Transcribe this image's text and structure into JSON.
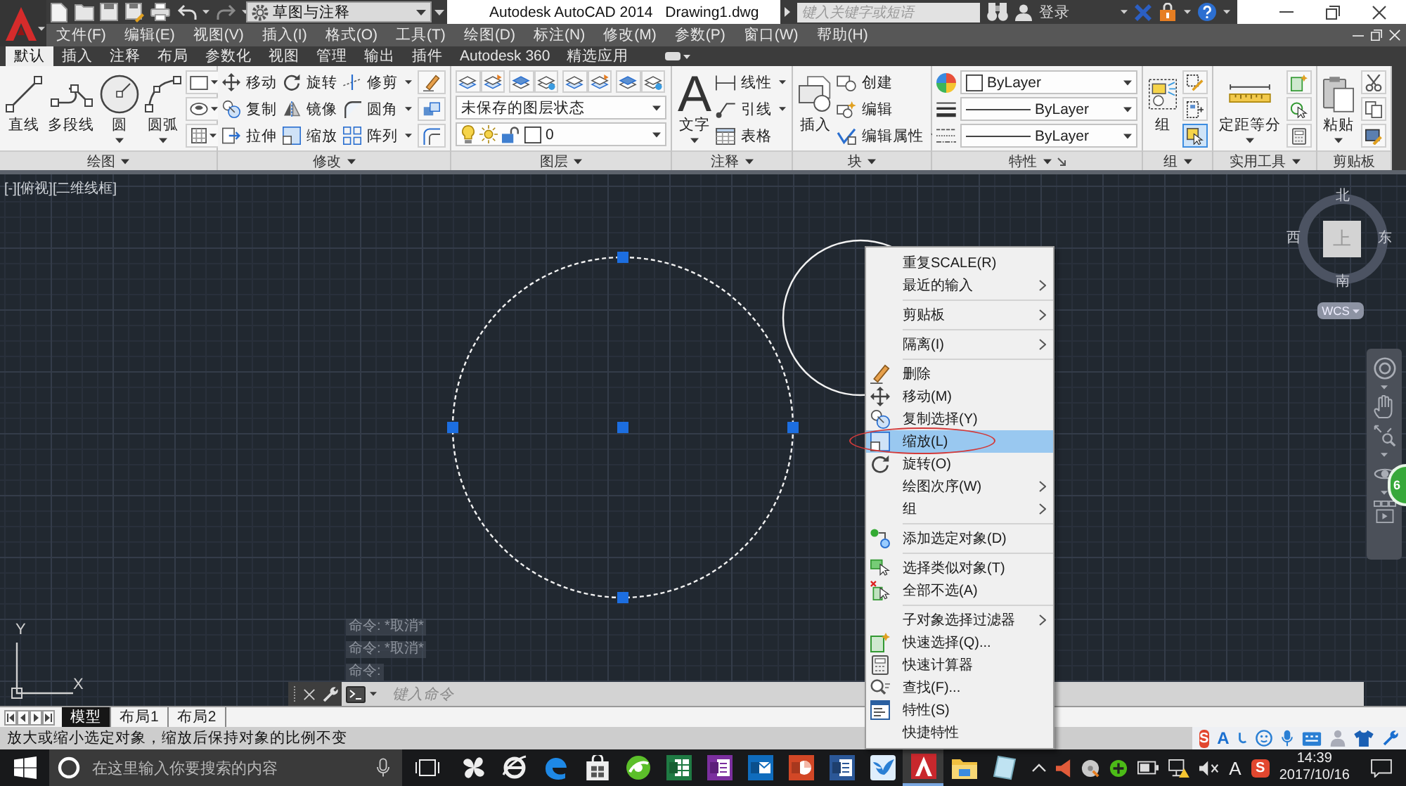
{
  "title_bar": {
    "workspace": "草图与注释",
    "app_title": "Autodesk AutoCAD 2014",
    "document": "Drawing1.dwg",
    "search": {
      "placeholder": "键入关键字或短语"
    },
    "sign_in": "登录"
  },
  "menu_bar": [
    "文件(F)",
    "编辑(E)",
    "视图(V)",
    "插入(I)",
    "格式(O)",
    "工具(T)",
    "绘图(D)",
    "标注(N)",
    "修改(M)",
    "参数(P)",
    "窗口(W)",
    "帮助(H)"
  ],
  "ribbon_tabs": [
    {
      "label": "默认",
      "selected": true
    },
    {
      "label": "插入",
      "selected": false
    },
    {
      "label": "注释",
      "selected": false
    },
    {
      "label": "布局",
      "selected": false
    },
    {
      "label": "参数化",
      "selected": false
    },
    {
      "label": "视图",
      "selected": false
    },
    {
      "label": "管理",
      "selected": false
    },
    {
      "label": "输出",
      "selected": false
    },
    {
      "label": "插件",
      "selected": false
    },
    {
      "label": "Autodesk 360",
      "selected": false
    },
    {
      "label": "精选应用",
      "selected": false
    }
  ],
  "ribbon_panels": {
    "draw": {
      "title": "绘图",
      "dropdown": true,
      "tools": [
        {
          "label": "直线",
          "dropdown": false
        },
        {
          "label": "多段线",
          "dropdown": false
        },
        {
          "label": "圆",
          "dropdown": true
        },
        {
          "label": "圆弧",
          "dropdown": true
        }
      ]
    },
    "modify": {
      "title": "修改",
      "dropdown": true,
      "tools": [
        {
          "label": "移动",
          "dropdown": false
        },
        {
          "label": "旋转",
          "dropdown": false
        },
        {
          "label": "修剪",
          "dropdown": true
        },
        {
          "label": "复制",
          "dropdown": false
        },
        {
          "label": "镜像",
          "dropdown": false
        },
        {
          "label": "圆角",
          "dropdown": true
        },
        {
          "label": "拉伸",
          "dropdown": false
        },
        {
          "label": "缩放",
          "dropdown": false
        },
        {
          "label": "阵列",
          "dropdown": true
        }
      ]
    },
    "layers": {
      "title": "图层",
      "dropdown": true,
      "layer_state": "未保存的图层状态",
      "current_layer": "0"
    },
    "annotation": {
      "title": "注释",
      "dropdown": true,
      "main_tool": {
        "icon_glyph": "A",
        "label": "文字",
        "dropdown": true
      },
      "tools": [
        {
          "label": "线性",
          "dropdown": true
        },
        {
          "label": "引线",
          "dropdown": true
        },
        {
          "label": "表格",
          "dropdown": false
        }
      ]
    },
    "block": {
      "title": "块",
      "dropdown": true,
      "main_tool": {
        "label": "插入",
        "dropdown": false
      },
      "tools": [
        {
          "label": "创建",
          "dropdown": false
        },
        {
          "label": "编辑",
          "dropdown": false
        },
        {
          "label": "编辑属性",
          "dropdown": true
        }
      ]
    },
    "properties": {
      "title": "特性",
      "dropdown": true,
      "color_setting": "ByLayer",
      "lineweight": "ByLayer",
      "linetype": "ByLayer"
    },
    "groups": {
      "title": "组",
      "dropdown": true,
      "main_tool": {
        "label": "组",
        "dropdown": false
      },
      "toggles": [
        {
          "on": false
        },
        {
          "on": false
        },
        {
          "on": true
        }
      ]
    },
    "utilities": {
      "title": "实用工具",
      "dropdown": true,
      "main_tool": {
        "label": "定距等分",
        "dropdown": true
      }
    },
    "clipboard": {
      "title": "剪贴板",
      "dropdown": false,
      "main_tool": {
        "label": "粘贴",
        "dropdown": true
      }
    }
  },
  "viewport": {
    "label": "[-][俯视][二维线框]",
    "objects": [
      {
        "kind": "circle",
        "selected": true
      },
      {
        "kind": "circle",
        "selected": false
      }
    ],
    "viewcube": {
      "north": "北",
      "west": "西",
      "face": "上",
      "east": "东",
      "south": "南",
      "coordinate_system": "WCS"
    },
    "side_badge": "6",
    "ucs": {
      "y": "Y",
      "x": "X"
    },
    "command_history": [
      "命令: *取消*",
      "命令: *取消*",
      "命令:"
    ],
    "command_line": {
      "placeholder": "键入命令"
    }
  },
  "layout_tabs": [
    {
      "label": "模型",
      "selected": true
    },
    {
      "label": "布局1",
      "selected": false
    },
    {
      "label": "布局2",
      "selected": false
    }
  ],
  "context_menu": [
    {
      "kind": "item",
      "label": "重复SCALE(R)",
      "submenu": false,
      "selected": false
    },
    {
      "kind": "item",
      "label": "最近的输入",
      "submenu": true,
      "selected": false
    },
    {
      "kind": "separator"
    },
    {
      "kind": "item",
      "label": "剪贴板",
      "submenu": true,
      "selected": false
    },
    {
      "kind": "separator"
    },
    {
      "kind": "item",
      "label": "隔离(I)",
      "submenu": true,
      "selected": false
    },
    {
      "kind": "separator"
    },
    {
      "kind": "item",
      "label": "删除",
      "submenu": false,
      "selected": false
    },
    {
      "kind": "item",
      "label": "移动(M)",
      "submenu": false,
      "selected": false
    },
    {
      "kind": "item",
      "label": "复制选择(Y)",
      "submenu": false,
      "selected": false
    },
    {
      "kind": "item",
      "label": "缩放(L)",
      "submenu": false,
      "selected": true
    },
    {
      "kind": "item",
      "label": "旋转(O)",
      "submenu": false,
      "selected": false
    },
    {
      "kind": "item",
      "label": "绘图次序(W)",
      "submenu": true,
      "selected": false
    },
    {
      "kind": "item",
      "label": "组",
      "submenu": true,
      "selected": false
    },
    {
      "kind": "separator"
    },
    {
      "kind": "item",
      "label": "添加选定对象(D)",
      "submenu": false,
      "selected": false
    },
    {
      "kind": "separator"
    },
    {
      "kind": "item",
      "label": "选择类似对象(T)",
      "submenu": false,
      "selected": false
    },
    {
      "kind": "item",
      "label": "全部不选(A)",
      "submenu": false,
      "selected": false
    },
    {
      "kind": "separator"
    },
    {
      "kind": "item",
      "label": "子对象选择过滤器",
      "submenu": true,
      "selected": false
    },
    {
      "kind": "item",
      "label": "快速选择(Q)...",
      "submenu": false,
      "selected": false
    },
    {
      "kind": "item",
      "label": "快速计算器",
      "submenu": false,
      "selected": false
    },
    {
      "kind": "item",
      "label": "查找(F)...",
      "submenu": false,
      "selected": false
    },
    {
      "kind": "item",
      "label": "特性(S)",
      "submenu": false,
      "selected": false
    },
    {
      "kind": "item",
      "label": "快捷特性",
      "submenu": false,
      "selected": false
    }
  ],
  "status_bar": {
    "prompt": "放大或缩小选定对象，缩放后保持对象的比例不变",
    "ime_logo": "S",
    "ime_mode": "A"
  },
  "taskbar": {
    "search": {
      "placeholder": "在这里输入你要搜索的内容"
    },
    "apps": [
      {
        "active": false
      },
      {
        "active": false
      },
      {
        "active": false
      },
      {
        "active": false
      },
      {
        "active": false
      },
      {
        "active": false
      },
      {
        "active": false
      },
      {
        "active": false
      },
      {
        "active": false
      },
      {
        "active": false
      },
      {
        "active": false
      },
      {
        "active": true
      },
      {
        "active": false
      },
      {
        "active": false
      }
    ],
    "tray": {
      "ime_mode": "A",
      "ime_logo": "S"
    },
    "time": "14:39",
    "date": "2017/10/16"
  }
}
